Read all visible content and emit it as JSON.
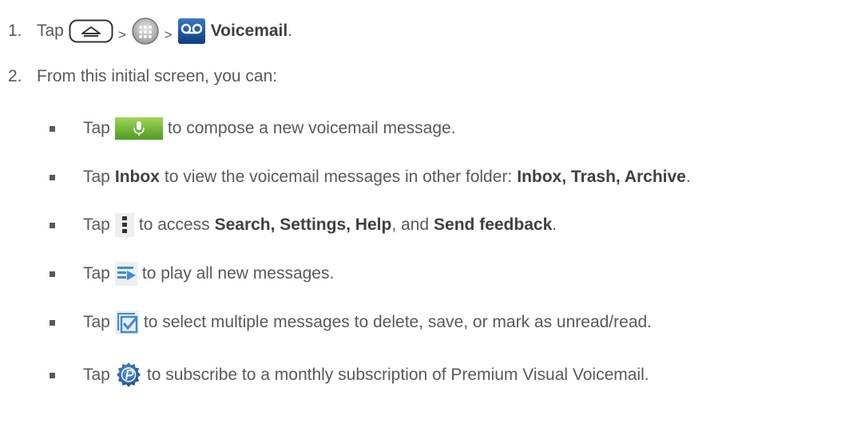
{
  "step1": {
    "number": "1.",
    "tap": "Tap",
    "sep1": ">",
    "sep2": ">",
    "app_name": "Voicemail",
    "end": ".",
    "icons": [
      "home-key-icon",
      "apps-icon",
      "voicemail-app-icon"
    ]
  },
  "step2": {
    "number": "2.",
    "text": "From this initial screen, you can:"
  },
  "bullets": [
    {
      "tap": "Tap",
      "icon": "compose-mic-icon",
      "text": "to compose a new voicemail message."
    },
    {
      "tap": "Tap",
      "bold1": "Inbox",
      "text": "to view the voicemail messages in other folder:",
      "bold2": "Inbox, Trash, Archive",
      "end": "."
    },
    {
      "tap": "Tap",
      "icon": "menu-dots-icon",
      "text": "to access",
      "bold1": "Search, Settings, Help",
      "mid": ", and",
      "bold2": "Send feedback",
      "end": "."
    },
    {
      "tap": "Tap",
      "icon": "play-all-icon",
      "text": "to play all new messages."
    },
    {
      "tap": "Tap",
      "icon": "select-multiple-icon",
      "text": "to select multiple messages to delete, save, or mark as unread/read."
    },
    {
      "tap": "Tap",
      "icon": "premium-badge-icon",
      "text": "to subscribe to a monthly subscription of Premium Visual Voicemail."
    }
  ]
}
